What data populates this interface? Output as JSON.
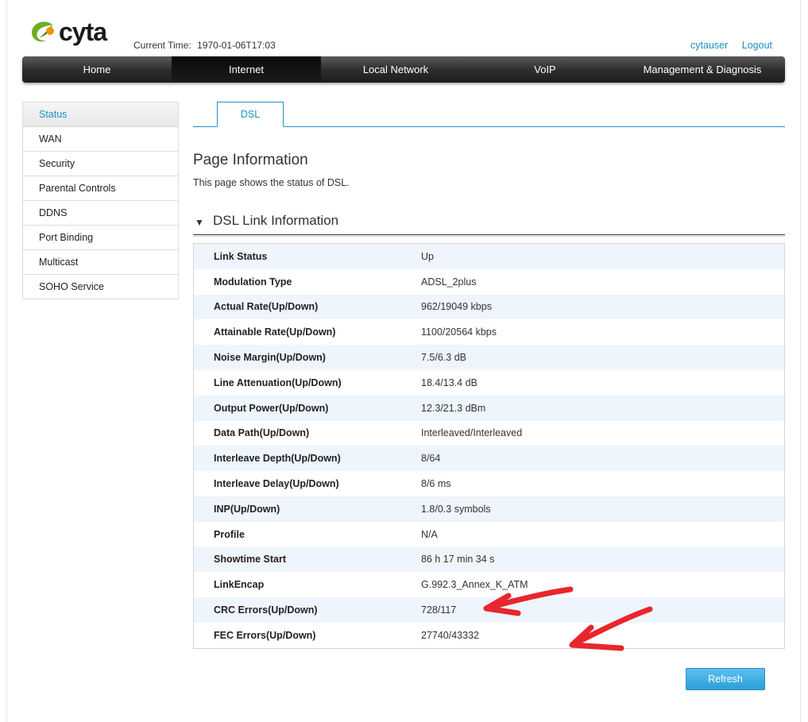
{
  "header": {
    "logo_text": "cyta",
    "current_time_label": "Current Time:",
    "current_time_value": "1970-01-06T17:03",
    "username": "cytauser",
    "logout": "Logout"
  },
  "nav": {
    "items": [
      {
        "label": "Home"
      },
      {
        "label": "Internet"
      },
      {
        "label": "Local Network"
      },
      {
        "label": "VoIP"
      },
      {
        "label": "Management & Diagnosis"
      }
    ],
    "active": "Internet"
  },
  "sidebar": {
    "items": [
      {
        "label": "Status"
      },
      {
        "label": "WAN"
      },
      {
        "label": "Security"
      },
      {
        "label": "Parental Controls"
      },
      {
        "label": "DDNS"
      },
      {
        "label": "Port Binding"
      },
      {
        "label": "Multicast"
      },
      {
        "label": "SOHO Service"
      }
    ],
    "active": "Status"
  },
  "tabs": [
    {
      "label": "DSL"
    }
  ],
  "main": {
    "page_title": "Page Information",
    "page_description": "This page shows the status of DSL.",
    "section_title": "DSL Link Information",
    "rows": [
      {
        "key": "Link Status",
        "value": "Up"
      },
      {
        "key": "Modulation Type",
        "value": "ADSL_2plus"
      },
      {
        "key": "Actual Rate(Up/Down)",
        "value": "962/19049 kbps"
      },
      {
        "key": "Attainable Rate(Up/Down)",
        "value": "1100/20564 kbps"
      },
      {
        "key": "Noise Margin(Up/Down)",
        "value": "7.5/6.3 dB"
      },
      {
        "key": "Line Attenuation(Up/Down)",
        "value": "18.4/13.4 dB"
      },
      {
        "key": "Output Power(Up/Down)",
        "value": "12.3/21.3 dBm"
      },
      {
        "key": "Data Path(Up/Down)",
        "value": "Interleaved/Interleaved"
      },
      {
        "key": "Interleave Depth(Up/Down)",
        "value": "8/64"
      },
      {
        "key": "Interleave Delay(Up/Down)",
        "value": "8/6 ms"
      },
      {
        "key": "INP(Up/Down)",
        "value": "1.8/0.3 symbols"
      },
      {
        "key": "Profile",
        "value": "N/A"
      },
      {
        "key": "Showtime Start",
        "value": "86 h 17 min 34 s"
      },
      {
        "key": "LinkEncap",
        "value": "G.992.3_Annex_K_ATM"
      },
      {
        "key": "CRC Errors(Up/Down)",
        "value": "728/117"
      },
      {
        "key": "FEC Errors(Up/Down)",
        "value": "27740/43332"
      }
    ],
    "refresh_label": "Refresh"
  },
  "colors": {
    "accent": "#1f8fc4",
    "nav_dark": "#1d1d1d",
    "row_alt": "#eef5fc",
    "annotation": "#e8141b",
    "logo_green": "#6ab023",
    "logo_orange": "#f39200"
  }
}
